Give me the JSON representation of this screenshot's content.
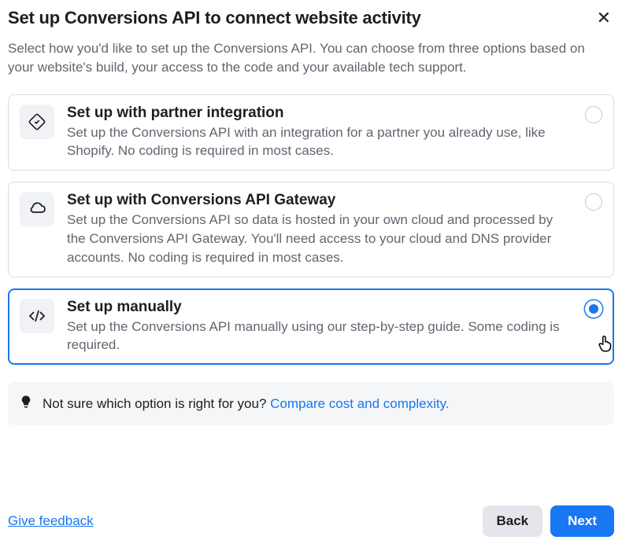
{
  "header": {
    "title": "Set up Conversions API to connect website activity",
    "subtitle": "Select how you'd like to set up the Conversions API. You can choose from three options based on your website's build, your access to the code and your available tech support."
  },
  "options": [
    {
      "title": "Set up with partner integration",
      "desc": "Set up the Conversions API with an integration for a partner you already use, like Shopify. No coding is required in most cases."
    },
    {
      "title": "Set up with Conversions API Gateway",
      "desc": "Set up the Conversions API so data is hosted in your own cloud and processed by the Conversions API Gateway. You'll need access to your cloud and DNS provider accounts. No coding is required in most cases."
    },
    {
      "title": "Set up manually",
      "desc": "Set up the Conversions API manually using our step-by-step guide. Some coding is required."
    }
  ],
  "hint": {
    "text": "Not sure which option is right for you? ",
    "linkText": "Compare cost and complexity."
  },
  "footer": {
    "feedback": "Give feedback",
    "back": "Back",
    "next": "Next"
  }
}
